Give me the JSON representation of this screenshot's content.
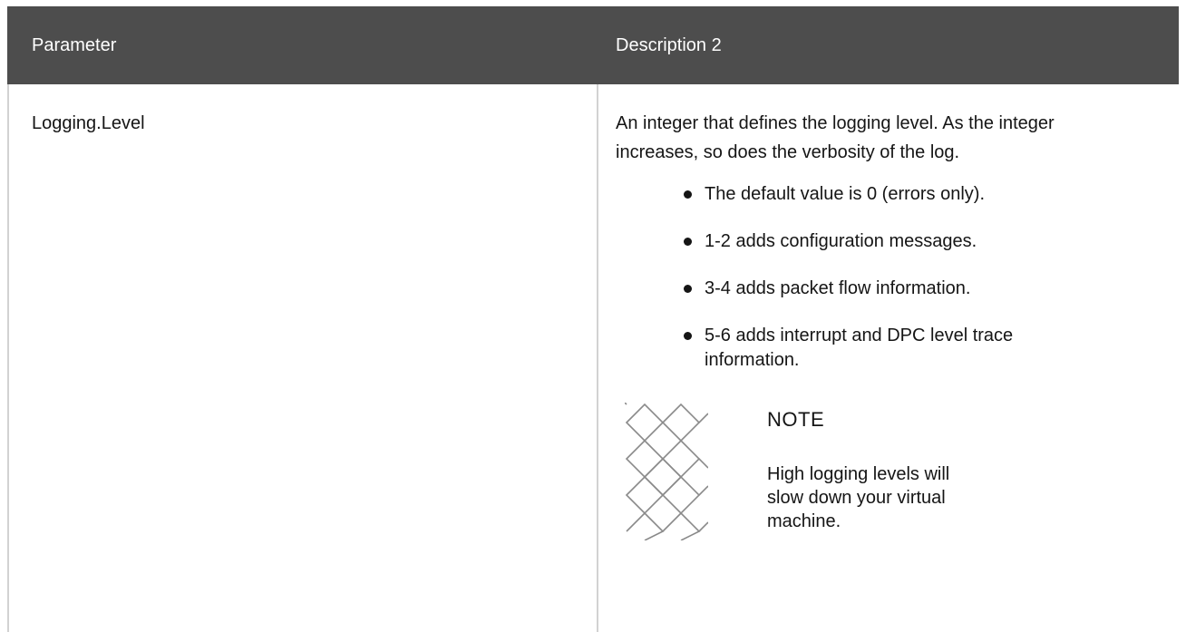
{
  "table": {
    "headers": {
      "parameter": "Parameter",
      "description": "Description 2"
    },
    "rows": [
      {
        "parameter": "Logging.Level",
        "description": "An integer that defines the logging level. As the integer increases, so does the verbosity of the log.",
        "bullets": [
          "The default value is 0 (errors only).",
          "1-2 adds configuration messages.",
          "3-4 adds packet flow information.",
          "5-6 adds interrupt and DPC level trace information."
        ],
        "note": {
          "icon": "note-icon",
          "title": "NOTE",
          "text": "High logging levels will slow down your virtual machine."
        }
      }
    ]
  },
  "colors": {
    "header_bg": "#4d4d4d",
    "header_text": "#ffffff",
    "border": "#d2d2d2",
    "text": "#151515"
  }
}
